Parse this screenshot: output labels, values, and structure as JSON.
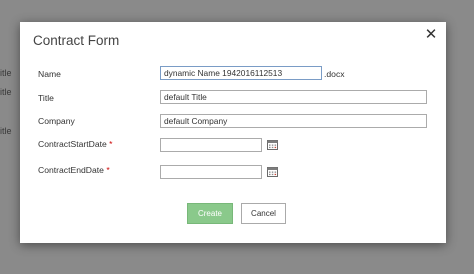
{
  "background": {
    "fragments": [
      "itle",
      "itle",
      "itle"
    ]
  },
  "dialog": {
    "title": "Contract Form",
    "close_glyph": "✕",
    "fields": {
      "name": {
        "label": "Name",
        "value": "dynamic Name 1942016112513",
        "suffix": ".docx"
      },
      "title": {
        "label": "Title",
        "value": "default Title"
      },
      "company": {
        "label": "Company",
        "value": "default Company"
      },
      "start_date": {
        "label": "ContractStartDate",
        "required_mark": "*",
        "value": "",
        "icon": "calendar-icon"
      },
      "end_date": {
        "label": "ContractEndDate",
        "required_mark": "*",
        "value": "",
        "icon": "calendar-icon"
      }
    },
    "buttons": {
      "create": "Create",
      "cancel": "Cancel"
    }
  },
  "colors": {
    "overlay": "#8a8a8a",
    "create_button": "#8ac98b",
    "required": "#cc0000"
  }
}
